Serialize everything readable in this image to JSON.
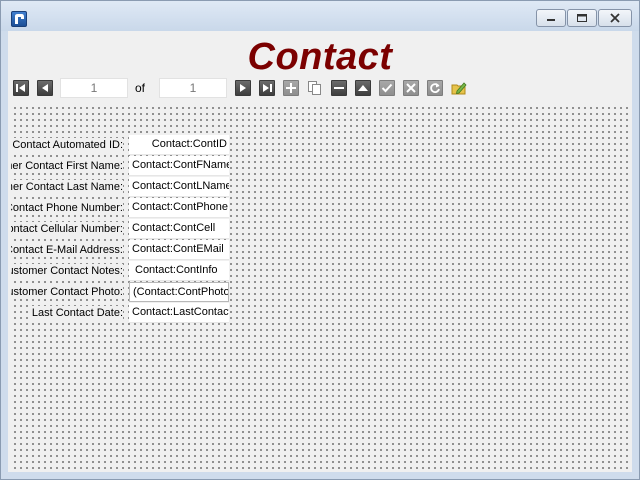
{
  "window": {
    "title": ""
  },
  "form": {
    "title": "Contact"
  },
  "toolbar": {
    "current_record": "1",
    "of_label": "of",
    "total_records": "1",
    "buttons": [
      "first-record",
      "previous-record",
      "next-record",
      "last-record",
      "add-record",
      "copy-record",
      "delete-record",
      "up",
      "save",
      "cancel",
      "refresh",
      "edit"
    ]
  },
  "fields": [
    {
      "label": "Contact Automated ID:",
      "value": "Contact:ContID"
    },
    {
      "label": "Customer Contact First Name:",
      "value": "Contact:ContFName"
    },
    {
      "label": "Customer Contact Last Name:",
      "value": "Contact:ContLName"
    },
    {
      "label": "Contact Phone Number:",
      "value": "Contact:ContPhone"
    },
    {
      "label": "Contact Cellular Number:",
      "value": "Contact:ContCell"
    },
    {
      "label": "Contact E-Mail Address:",
      "value": "Contact:ContEMail"
    },
    {
      "label": "Customer Contact Notes:",
      "value": "Contact:ContInfo"
    },
    {
      "label": "Customer Contact Photo:",
      "value": "(Contact:ContPhoto)"
    },
    {
      "label": "Last Contact Date:",
      "value": "Contact:LastContactDate"
    }
  ]
}
